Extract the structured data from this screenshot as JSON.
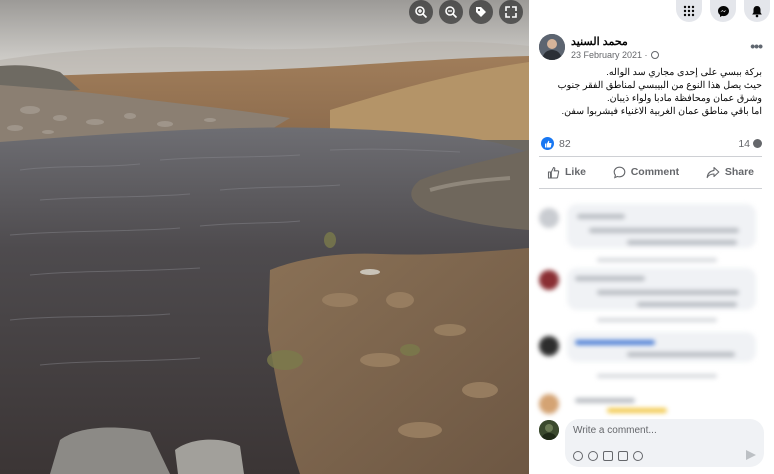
{
  "photo": {
    "alt": "Pond in a rocky valley",
    "tools": [
      {
        "icon": "zoom-in-icon"
      },
      {
        "icon": "zoom-out-icon"
      },
      {
        "icon": "tag-icon"
      },
      {
        "icon": "fullscreen-icon"
      }
    ]
  },
  "topbar": {
    "items": [
      {
        "icon": "apps-grid-icon"
      },
      {
        "icon": "messenger-icon"
      },
      {
        "icon": "notifications-bell-icon"
      }
    ]
  },
  "post": {
    "author": "محمد السنيد",
    "date": "23 February 2021 ·",
    "privacy_icon": "globe-icon",
    "more_icon": "more-options-icon",
    "text_lines": [
      "بركة ببسي على إحدى مجاري سد الواله.",
      "حيث يصل هذا النوع من البيبسي لمناطق الفقر جنوب",
      "وشرق عمان ومحافظة مادبا ولواء ذيبان.",
      "اما باقي مناطق عمان الغربية الاغنياء فيشربوا سفن."
    ]
  },
  "reactions": {
    "count": "82",
    "comments": "14",
    "like_icon": "like-reaction-icon"
  },
  "actions": {
    "like": "Like",
    "comment": "Comment",
    "share": "Share"
  },
  "composer": {
    "placeholder": "Write a comment..."
  },
  "colors": {
    "brand_blue": "#1877f2",
    "secondary_text": "#65676b",
    "input_bg": "#f0f2f5"
  }
}
